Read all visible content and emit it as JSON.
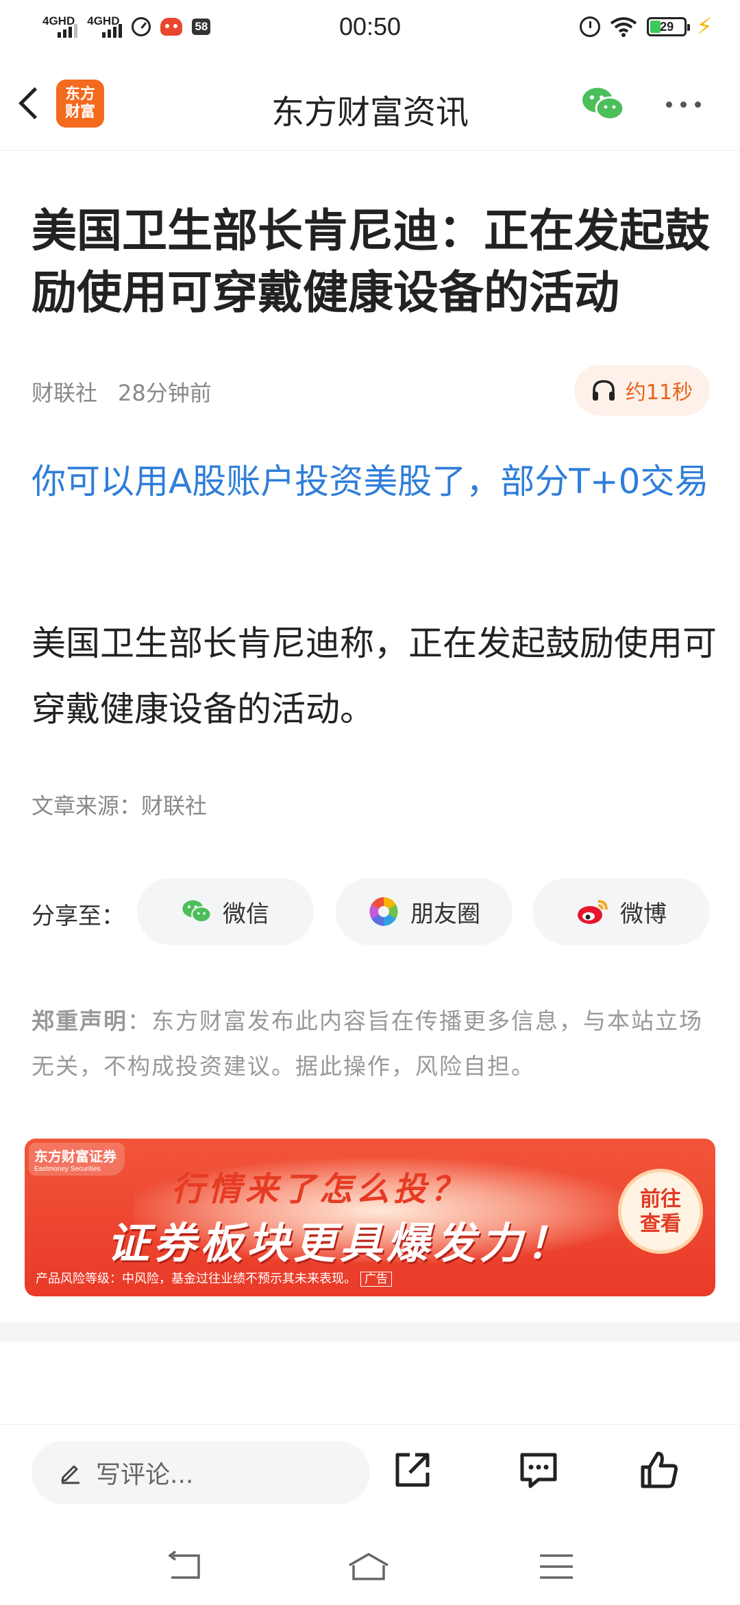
{
  "status_bar": {
    "network1": "4GHD",
    "network2": "4GHD",
    "badge": "58",
    "time": "00:50",
    "battery_level": 29,
    "battery_text": "29"
  },
  "header": {
    "logo_line1": "东方",
    "logo_line2": "财富",
    "title": "东方财富资讯"
  },
  "article": {
    "title": "美国卫生部长肯尼迪：正在发起鼓励使用可穿戴健康设备的活动",
    "source_name": "财联社",
    "time_ago": "28分钟前",
    "audio_duration": "约11秒",
    "promo_link": "你可以用A股账户投资美股了，部分T+0交易",
    "body": "美国卫生部长肯尼迪称，正在发起鼓励使用可穿戴健康设备的活动。",
    "source_line": "文章来源：财联社"
  },
  "share": {
    "label": "分享至：",
    "wechat": "微信",
    "moments": "朋友圈",
    "weibo": "微博"
  },
  "disclaimer": {
    "title": "郑重声明",
    "text": "：东方财富发布此内容旨在传播更多信息，与本站立场无关，不构成投资建议。据此操作，风险自担。"
  },
  "ad": {
    "brand_cn": "东方财富证券",
    "brand_en": "Eastmoney Securities",
    "line1": "行情来了怎么投？",
    "line2": "证券板块更具爆发力！",
    "cta_line1": "前往",
    "cta_line2": "查看",
    "risk": "产品风险等级：中风险，基金过往业绩不预示其未来表现。",
    "tag": "广告"
  },
  "bottom_bar": {
    "comment_placeholder": "写评论..."
  },
  "colors": {
    "accent_orange": "#f46a1f",
    "link_blue": "#2f7ed8",
    "ad_red": "#e93a28"
  }
}
